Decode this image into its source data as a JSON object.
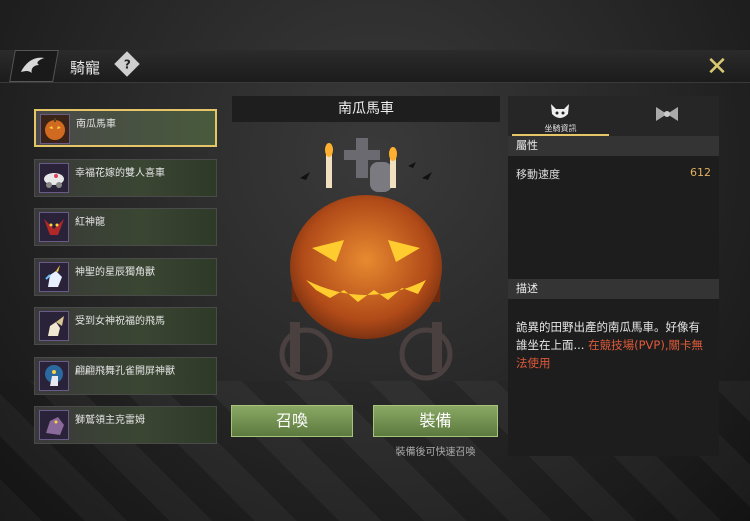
{
  "header": {
    "title": "騎寵",
    "help": "?",
    "close": "✕"
  },
  "mounts": [
    {
      "name": "南瓜馬車",
      "selected": true,
      "icon": "pumpkin-icon"
    },
    {
      "name": "幸福花嫁的雙人喜車",
      "selected": false,
      "icon": "wedding-cart-icon"
    },
    {
      "name": "紅神龍",
      "selected": false,
      "icon": "red-dragon-icon"
    },
    {
      "name": "神聖的星辰獨角獸",
      "selected": false,
      "icon": "unicorn-icon"
    },
    {
      "name": "受到女神祝福的飛馬",
      "selected": false,
      "icon": "pegasus-icon"
    },
    {
      "name": "翩翩飛舞孔雀開屏神獸",
      "selected": false,
      "icon": "peacock-beast-icon"
    },
    {
      "name": "獅鷲領主克雷姆",
      "selected": false,
      "icon": "griffin-icon"
    }
  ],
  "preview": {
    "name": "南瓜馬車"
  },
  "actions": {
    "summon": "召喚",
    "equip": "裝備",
    "equip_hint": "裝備後可快速召喚"
  },
  "info_tabs": {
    "mount_info": "坐騎資訊",
    "costume_icon": "bow-icon"
  },
  "attributes": {
    "header": "屬性",
    "move_speed_label": "移動速度",
    "move_speed_value": "612"
  },
  "description": {
    "header": "描述",
    "text": "詭異的田野出產的南瓜馬車。好像有誰坐在上面...",
    "restriction": "在競技場(PVP),關卡無法使用"
  },
  "colors": {
    "accent": "#e6c468",
    "button": "#7a9a54",
    "warning": "#e05a3a",
    "value": "#e0b060"
  }
}
